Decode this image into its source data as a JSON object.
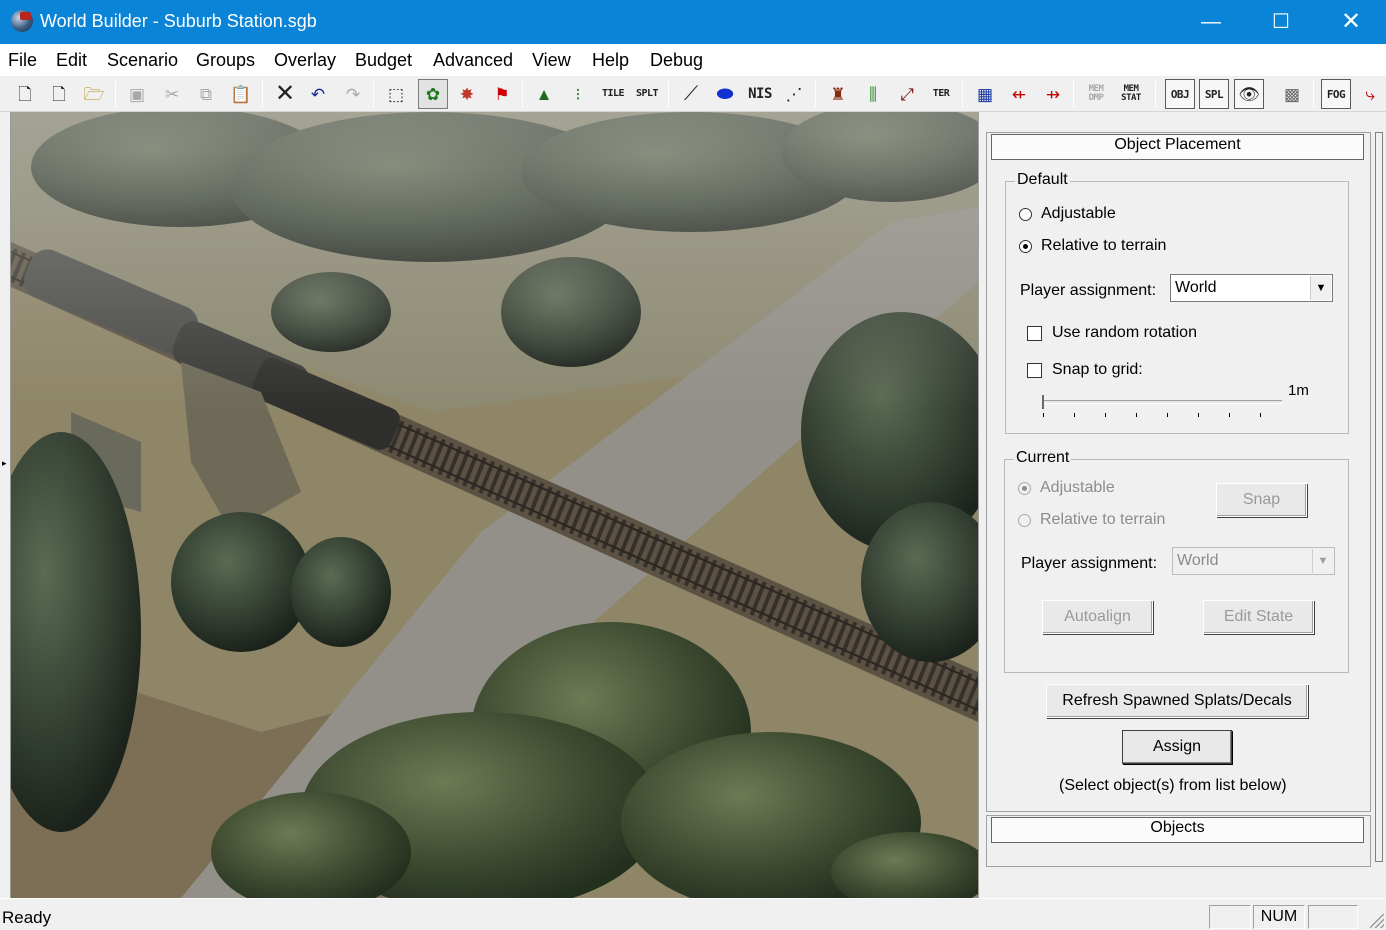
{
  "window": {
    "title": "World Builder - Suburb Station.sgb",
    "controls": {
      "minimize": "—",
      "maximize": "☐",
      "close": "✕"
    }
  },
  "menu": [
    "File",
    "Edit",
    "Scenario",
    "Groups",
    "Overlay",
    "Budget",
    "Advanced",
    "View",
    "Help",
    "Debug"
  ],
  "toolbar": {
    "text_buttons": {
      "tile": "TILE",
      "splt": "SPLT",
      "nis": "NIS",
      "ter": "TER",
      "mem_dmp": "MEM DMP",
      "mem_stat": "MEM STAT",
      "obj": "OBJ",
      "spl": "SPL",
      "fog": "FOG"
    },
    "icons": [
      "new-file-icon",
      "new-document-icon",
      "open-folder-icon",
      "save-icon",
      "cut-icon",
      "copy-icon",
      "paste-icon",
      "delete-icon",
      "undo-icon",
      "redo-icon",
      "select-region-icon",
      "place-trees-icon",
      "paint-icon",
      "flag-icon",
      "tank-icon",
      "traffic-light-icon",
      "road-icon",
      "water-icon",
      "cliff-icon",
      "unit-icon",
      "heightmap-icon",
      "line-tool-icon",
      "calendar-icon",
      "move-left-icon",
      "move-right-icon",
      "view-object-icon",
      "checker-icon",
      "eye-tool-icon"
    ]
  },
  "panel": {
    "rollout_title": "Object Placement",
    "default_group": {
      "legend": "Default",
      "radio_adjustable": "Adjustable",
      "radio_relative": "Relative to terrain",
      "relative_checked": true,
      "player_assignment_label": "Player assignment:",
      "player_assignment_value": "World",
      "random_rotation": "Use random rotation",
      "random_rotation_checked": false,
      "snap_to_grid": "Snap to grid:",
      "snap_to_grid_checked": false,
      "grid_value": "1m",
      "grid_slider_fraction": 0.0
    },
    "current_group": {
      "legend": "Current",
      "radio_adjustable": "Adjustable",
      "radio_relative": "Relative to terrain",
      "adjustable_checked": true,
      "snap_button": "Snap",
      "player_assignment_label": "Player assignment:",
      "player_assignment_value": "World",
      "autoalign_button": "Autoalign",
      "edit_state_button": "Edit State"
    },
    "refresh_button": "Refresh Spawned Splats/Decals",
    "assign_button": "Assign",
    "assign_hint": "(Select object(s) from list below)",
    "objects_rollout": "Objects"
  },
  "status": {
    "message": "Ready",
    "indicator_num": "NUM"
  },
  "colors": {
    "titlebar": "#0a84d6",
    "viewport_ground": "#8b8467",
    "road": "#8e8c86",
    "forest": "#3d4a30"
  }
}
